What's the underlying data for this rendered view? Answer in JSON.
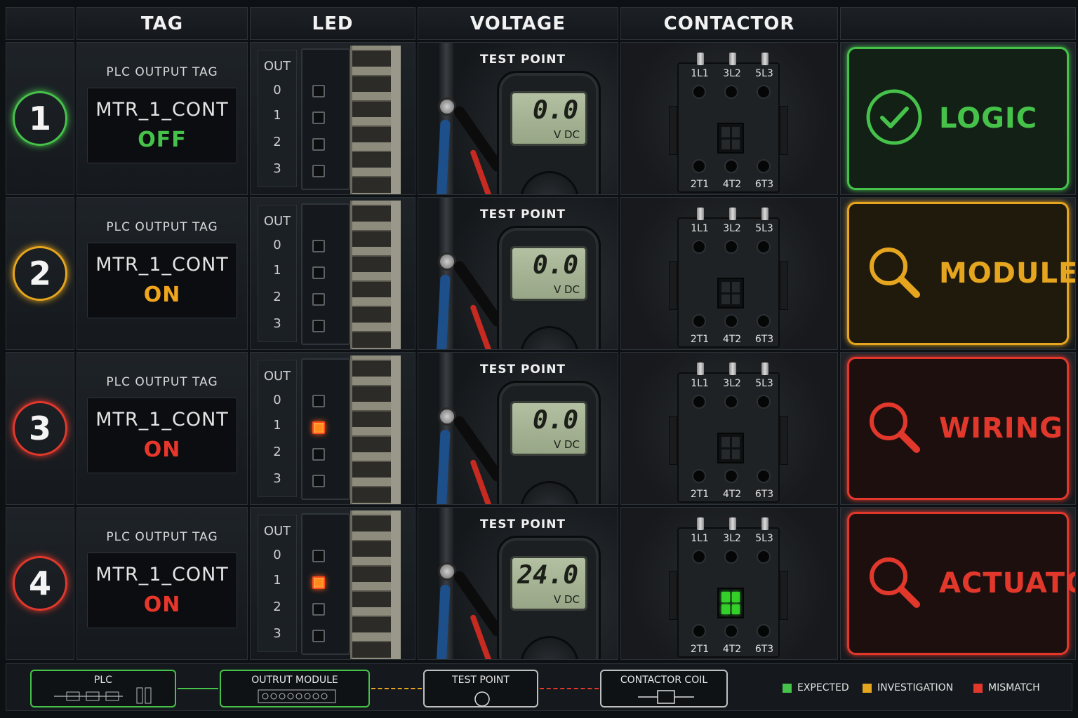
{
  "headers": {
    "tag": "TAG",
    "led": "LED",
    "voltage": "VOLTAGE",
    "contactor": "CONTACTOR"
  },
  "colors": {
    "expected": "#46c24a",
    "investigation": "#e6a51e",
    "mismatch": "#e2382c"
  },
  "rows": [
    {
      "num": "1",
      "tag_caption": "PLC OUTPUT TAG",
      "tag_name": "MTR_1_CONT",
      "tag_state": "OFF",
      "state_color": "#46c24a",
      "out_label": "OUT",
      "out_nums": [
        "0",
        "1",
        "2",
        "3"
      ],
      "lit_led_index": null,
      "tp_label": "TEST POINT",
      "meter_value": "0.0",
      "meter_unit": "V DC",
      "terminals_top": [
        "1L1",
        "3L2",
        "5L3"
      ],
      "terminals_bottom": [
        "2T1",
        "4T2",
        "6T3"
      ],
      "contactor_engaged": false,
      "result": "LOGIC",
      "result_icon": "check-circle-icon",
      "color": "#46c24a",
      "result_bg": "#122015"
    },
    {
      "num": "2",
      "tag_caption": "PLC OUTPUT TAG",
      "tag_name": "MTR_1_CONT",
      "tag_state": "ON",
      "state_color": "#f0a51c",
      "out_label": "OUT",
      "out_nums": [
        "0",
        "1",
        "2",
        "3"
      ],
      "lit_led_index": null,
      "tp_label": "TEST POINT",
      "meter_value": "0.0",
      "meter_unit": "V DC",
      "terminals_top": [
        "1L1",
        "3L2",
        "5L3"
      ],
      "terminals_bottom": [
        "2T1",
        "4T2",
        "6T3"
      ],
      "contactor_engaged": false,
      "result": "MODULE",
      "result_icon": "magnifier-icon",
      "color": "#e6a51e",
      "result_bg": "#1f1a0c"
    },
    {
      "num": "3",
      "tag_caption": "PLC OUTPUT TAG",
      "tag_name": "MTR_1_CONT",
      "tag_state": "ON",
      "state_color": "#e8372a",
      "out_label": "OUT",
      "out_nums": [
        "0",
        "1",
        "2",
        "3"
      ],
      "lit_led_index": 1,
      "tp_label": "TEST POINT",
      "meter_value": "0.0",
      "meter_unit": "V DC",
      "terminals_top": [
        "1L1",
        "3L2",
        "5L3"
      ],
      "terminals_bottom": [
        "2T1",
        "4T2",
        "6T3"
      ],
      "contactor_engaged": false,
      "result": "WIRING",
      "result_icon": "magnifier-icon",
      "color": "#e2382c",
      "result_bg": "#1e0f0f"
    },
    {
      "num": "4",
      "tag_caption": "PLC OUTPUT TAG",
      "tag_name": "MTR_1_CONT",
      "tag_state": "ON",
      "state_color": "#e8372a",
      "out_label": "OUT",
      "out_nums": [
        "0",
        "1",
        "2",
        "3"
      ],
      "lit_led_index": 1,
      "tp_label": "TEST POINT",
      "meter_value": "24.0",
      "meter_unit": "V DC",
      "terminals_top": [
        "1L1",
        "3L2",
        "5L3"
      ],
      "terminals_bottom": [
        "2T1",
        "4T2",
        "6T3"
      ],
      "contactor_engaged": true,
      "result": "ACTUATOR",
      "result_icon": "magnifier-icon",
      "color": "#e2382c",
      "result_bg": "#1e0f0f"
    }
  ],
  "footer": {
    "plc": "PLC",
    "output_module": "OUTRUT MODULE",
    "test_point": "TEST POINT",
    "contactor_coil": "CONTACTOR COIL",
    "legend": [
      {
        "label": "EXPECTED",
        "color": "#46c24a"
      },
      {
        "label": "INVESTIGATION",
        "color": "#e6a51e"
      },
      {
        "label": "MISMATCH",
        "color": "#e2382c"
      }
    ]
  }
}
